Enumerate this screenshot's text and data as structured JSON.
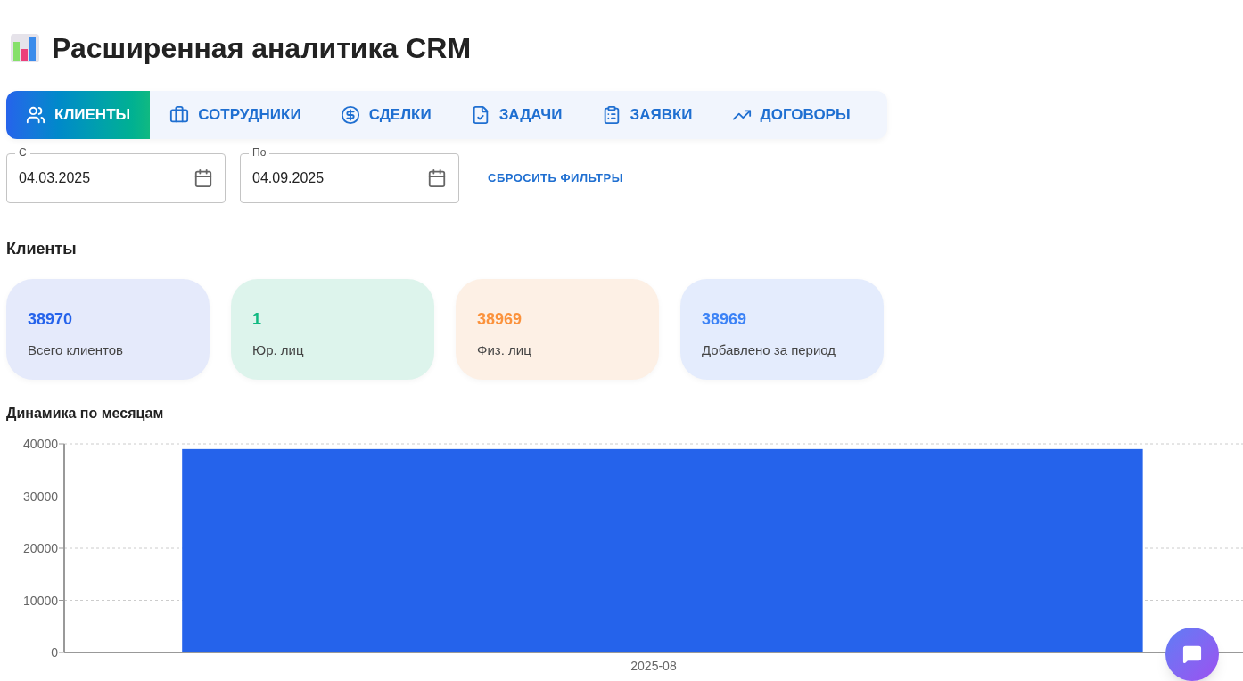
{
  "title": "Расширенная аналитика CRM",
  "tabs": [
    {
      "label": "КЛИЕНТЫ",
      "selected": true
    },
    {
      "label": "СОТРУДНИКИ",
      "selected": false
    },
    {
      "label": "СДЕЛКИ",
      "selected": false
    },
    {
      "label": "ЗАДАЧИ",
      "selected": false
    },
    {
      "label": "ЗАЯВКИ",
      "selected": false
    },
    {
      "label": "ДОГОВОРЫ",
      "selected": false
    }
  ],
  "filters": {
    "from": {
      "label": "С",
      "value": "04.03.2025"
    },
    "to": {
      "label": "По",
      "value": "04.09.2025"
    },
    "reset": "СБРОСИТЬ ФИЛЬТРЫ"
  },
  "section_title": "Клиенты",
  "stats": [
    {
      "value": "38970",
      "label": "Всего клиентов",
      "color": "#2563eb"
    },
    {
      "value": "1",
      "label": "Юр. лиц",
      "color": "#10b981"
    },
    {
      "value": "38969",
      "label": "Физ. лиц",
      "color": "#fb923c"
    },
    {
      "value": "38969",
      "label": "Добавлено за период",
      "color": "#3b82f6"
    }
  ],
  "chart_title": "Динамика по месяцам",
  "chart_data": {
    "type": "bar",
    "categories": [
      "2025-08"
    ],
    "series": [
      {
        "color": "#2563eb",
        "values": [
          39000
        ]
      }
    ],
    "grid": true,
    "ylim": [
      0,
      40000
    ],
    "yticks": [
      0,
      10000,
      20000,
      30000,
      40000
    ]
  }
}
